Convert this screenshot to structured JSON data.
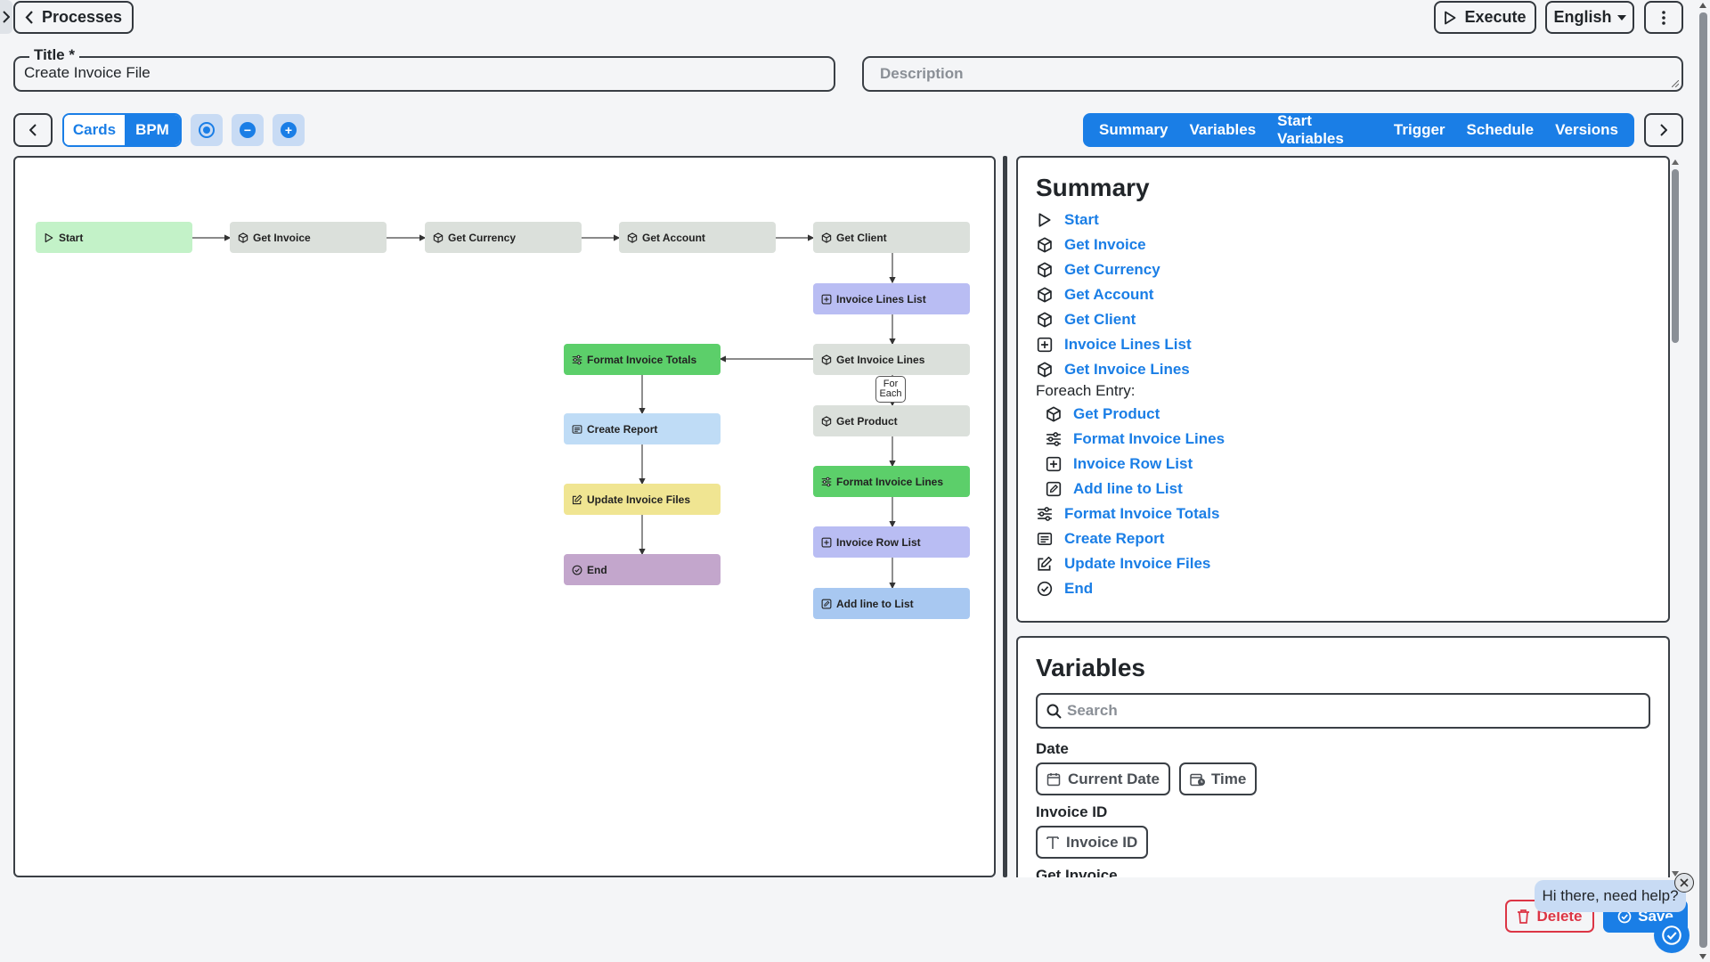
{
  "header": {
    "back_label": "Processes",
    "execute_label": "Execute",
    "language": "English"
  },
  "form": {
    "title_label": "Title *",
    "title_value": "Create Invoice File",
    "description_placeholder": "Description"
  },
  "toolbar": {
    "view_cards": "Cards",
    "view_bpm": "BPM",
    "tabs": [
      "Summary",
      "Variables",
      "Start Variables",
      "Trigger",
      "Schedule",
      "Versions"
    ]
  },
  "canvas": {
    "nodes": [
      {
        "id": "start",
        "label": "Start",
        "icon": "play-icon",
        "color": "#c3f2c8"
      },
      {
        "id": "get-invoice",
        "label": "Get Invoice",
        "icon": "cube-icon",
        "color": "#dbe0db"
      },
      {
        "id": "get-currency",
        "label": "Get Currency",
        "icon": "cube-icon",
        "color": "#dbe0db"
      },
      {
        "id": "get-account",
        "label": "Get Account",
        "icon": "cube-icon",
        "color": "#dbe0db"
      },
      {
        "id": "get-client",
        "label": "Get Client",
        "icon": "cube-icon",
        "color": "#dbe0db"
      },
      {
        "id": "invoice-lines-list",
        "label": "Invoice Lines List",
        "icon": "plus-square-icon",
        "color": "#b9bdf3"
      },
      {
        "id": "get-invoice-lines",
        "label": "Get Invoice Lines",
        "icon": "cube-icon",
        "color": "#dbe0db"
      },
      {
        "id": "format-invoice-totals",
        "label": "Format Invoice Totals",
        "icon": "sliders-icon",
        "color": "#5ccf6a"
      },
      {
        "id": "get-product",
        "label": "Get Product",
        "icon": "cube-icon",
        "color": "#dbe0db"
      },
      {
        "id": "create-report",
        "label": "Create Report",
        "icon": "report-icon",
        "color": "#bfdcf6"
      },
      {
        "id": "format-invoice-lines",
        "label": "Format Invoice Lines",
        "icon": "sliders-icon",
        "color": "#5ccf6a"
      },
      {
        "id": "update-invoice-files",
        "label": "Update Invoice Files",
        "icon": "edit-icon",
        "color": "#f0e592"
      },
      {
        "id": "invoice-row-list",
        "label": "Invoice Row List",
        "icon": "plus-square-icon",
        "color": "#b9bdf3"
      },
      {
        "id": "end",
        "label": "End",
        "icon": "check-circle-icon",
        "color": "#c3a6cc"
      },
      {
        "id": "add-line-to-list",
        "label": "Add line to List",
        "icon": "edit-square-icon",
        "color": "#a8c8f1"
      }
    ],
    "foreach_label_1": "For",
    "foreach_label_2": "Each"
  },
  "summary": {
    "title": "Summary",
    "items": [
      {
        "label": "Start",
        "icon": "play-icon"
      },
      {
        "label": "Get Invoice",
        "icon": "cube-icon"
      },
      {
        "label": "Get Currency",
        "icon": "cube-icon"
      },
      {
        "label": "Get Account",
        "icon": "cube-icon"
      },
      {
        "label": "Get Client",
        "icon": "cube-icon"
      },
      {
        "label": "Invoice Lines List",
        "icon": "plus-square-icon"
      },
      {
        "label": "Get Invoice Lines",
        "icon": "cube-icon"
      }
    ],
    "foreach_label": "Foreach Entry:",
    "foreach_items": [
      {
        "label": "Get Product",
        "icon": "cube-icon"
      },
      {
        "label": "Format Invoice Lines",
        "icon": "sliders-icon"
      },
      {
        "label": "Invoice Row List",
        "icon": "plus-square-icon"
      },
      {
        "label": "Add line to List",
        "icon": "edit-square-icon"
      }
    ],
    "tail_items": [
      {
        "label": "Format Invoice Totals",
        "icon": "sliders-icon"
      },
      {
        "label": "Create Report",
        "icon": "report-icon"
      },
      {
        "label": "Update Invoice Files",
        "icon": "edit-icon"
      },
      {
        "label": "End",
        "icon": "check-circle-icon"
      }
    ]
  },
  "variables": {
    "title": "Variables",
    "search_placeholder": "Search",
    "groups": [
      {
        "name": "Date",
        "chips": [
          {
            "label": "Current Date",
            "icon": "calendar-icon"
          },
          {
            "label": "Time",
            "icon": "calendar-clock-icon"
          }
        ]
      },
      {
        "name": "Invoice ID",
        "chips": [
          {
            "label": "Invoice ID",
            "icon": "text-icon"
          }
        ]
      }
    ],
    "next_group": "Get Invoice"
  },
  "footer": {
    "delete_label": "Delete",
    "save_label": "Save",
    "help_text": "Hi there, need help?"
  },
  "colors": {
    "accent": "#1a7ee6",
    "danger": "#dc3545"
  }
}
